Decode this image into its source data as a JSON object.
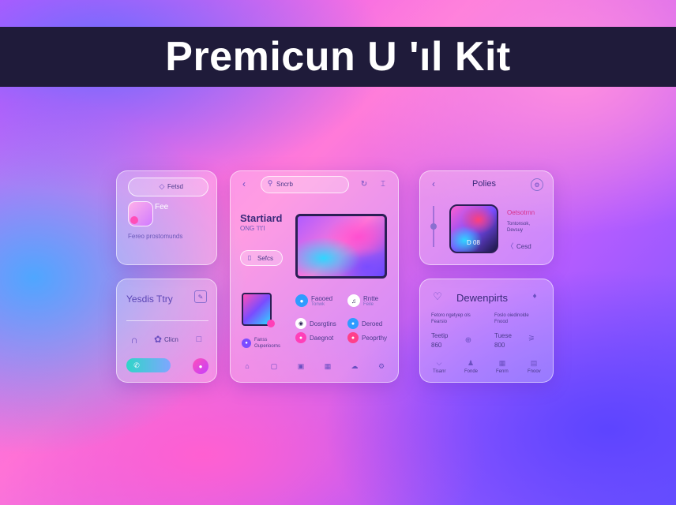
{
  "banner": {
    "title": "Premicun U 'ıl Kit"
  },
  "card1": {
    "search_label": "Fetsd",
    "name": "Fee",
    "caption": "Fereo prostomunds"
  },
  "card2": {
    "title": "Yesdis Ttry",
    "item_label": "Clicn"
  },
  "card3": {
    "search_label": "Sncrb",
    "heading": "Startiard",
    "subheading": "ONG 'I't'I",
    "button_label": "Sefcs",
    "list_items": [
      {
        "title": "Faooed",
        "sub": "Tonwk"
      },
      {
        "title": "Rntte",
        "sub": "Feile"
      },
      {
        "title": "Dosrgtins",
        "sub": ""
      },
      {
        "title": "Deroed",
        "sub": ""
      },
      {
        "title": "Daegnot",
        "sub": ""
      },
      {
        "title": "Peoprthy",
        "sub": ""
      }
    ],
    "footer_item": {
      "title": "Fanss",
      "sub": "Ouperioorns"
    }
  },
  "card4": {
    "title": "Polies",
    "artwork_text": "D 08",
    "detail_title": "Oetsotrnn",
    "detail_lines": [
      "Tontonsok,",
      "Devsuy"
    ],
    "action_label": "Cesd"
  },
  "card5": {
    "title": "Dewenpirts",
    "stats": [
      {
        "top": "Fetoro ngetyep ols",
        "mid": "Teetip",
        "bottom": "860"
      },
      {
        "top": "Foslo oiedinolde",
        "mid": "Tuese",
        "bottom": "800"
      }
    ],
    "small_labels": [
      "Fearsio",
      "Fnood"
    ],
    "footer_labels": [
      "Tisanr",
      "Fonde",
      "Fenrn",
      "Fnoov"
    ]
  },
  "colors": {
    "banner_bg": "#1f1b3a",
    "accent_pink": "#ff3fb8",
    "accent_blue": "#2f9bff",
    "accent_purple": "#7a4cff",
    "toggle_gradient_start": "#2fd6c8",
    "toggle_gradient_end": "#7fa6ff"
  }
}
